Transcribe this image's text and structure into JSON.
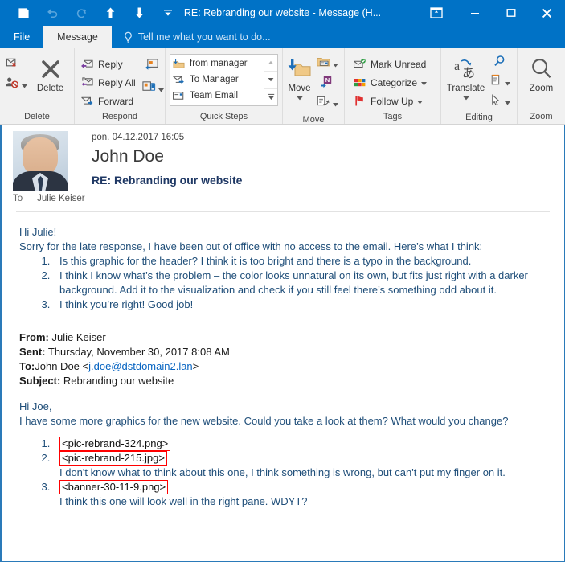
{
  "titlebar": {
    "quick_access": [
      {
        "name": "save",
        "icon": "save-icon",
        "enabled": true
      },
      {
        "name": "undo",
        "icon": "undo-icon",
        "enabled": false
      },
      {
        "name": "redo",
        "icon": "redo-icon",
        "enabled": false
      },
      {
        "name": "previous-item",
        "icon": "up-arrow-icon",
        "enabled": true
      },
      {
        "name": "next-item",
        "icon": "down-arrow-icon",
        "enabled": true
      },
      {
        "name": "customize-quick-access-toolbar",
        "icon": "chevron-down-icon",
        "enabled": true
      }
    ],
    "title": "RE: Rebranding our website - Message (H...",
    "window_controls": [
      {
        "name": "ribbon-display-options",
        "icon": "ribbon-options-icon"
      },
      {
        "name": "minimize",
        "icon": "minimize-icon"
      },
      {
        "name": "maximize",
        "icon": "maximize-icon"
      },
      {
        "name": "close",
        "icon": "close-icon"
      }
    ]
  },
  "tabs": {
    "file": "File",
    "message": "Message",
    "tellme_placeholder": "Tell me what you want to do...",
    "tellme_icon": "lightbulb-icon"
  },
  "ribbon": {
    "groups": [
      {
        "label": "Delete",
        "buttons": [
          {
            "label": "",
            "name": "ignore-button",
            "icon": "ignore-icon"
          },
          {
            "label": "",
            "name": "junk-button",
            "icon": "junk-person-icon"
          },
          {
            "label": "Delete",
            "name": "delete-button",
            "icon": "delete-x-icon"
          }
        ]
      },
      {
        "label": "Respond",
        "buttons": [
          {
            "label": "Reply",
            "name": "reply-button",
            "icon": "reply-icon"
          },
          {
            "label": "Reply All",
            "name": "reply-all-button",
            "icon": "reply-all-icon"
          },
          {
            "label": "Forward",
            "name": "forward-button",
            "icon": "forward-icon"
          },
          {
            "label": "",
            "name": "meeting-button",
            "icon": "meeting-icon"
          },
          {
            "label": "",
            "name": "more-respond-button",
            "icon": "more-respond-icon"
          }
        ]
      },
      {
        "label": "Quick Steps",
        "items": [
          {
            "label": "from manager",
            "name": "quick-step-from-manager",
            "icon": "move-to-folder-icon"
          },
          {
            "label": "To Manager",
            "name": "quick-step-to-manager",
            "icon": "forward-mail-icon"
          },
          {
            "label": "Team Email",
            "name": "quick-step-team-email",
            "icon": "team-email-icon"
          }
        ],
        "has_dialog_launcher": true
      },
      {
        "label": "Move",
        "buttons": [
          {
            "label": "Move",
            "name": "move-button",
            "icon": "move-folder-icon"
          },
          {
            "label": "",
            "name": "rules-button",
            "icon": "rules-icon"
          },
          {
            "label": "",
            "name": "onenote-button",
            "icon": "onenote-icon"
          },
          {
            "label": "",
            "name": "actions-button",
            "icon": "actions-icon"
          }
        ]
      },
      {
        "label": "Tags",
        "buttons": [
          {
            "label": "Mark Unread",
            "name": "mark-unread-button",
            "icon": "mark-unread-icon"
          },
          {
            "label": "Categorize",
            "name": "categorize-button",
            "icon": "categorize-icon"
          },
          {
            "label": "Follow Up",
            "name": "follow-up-button",
            "icon": "flag-icon"
          }
        ],
        "has_dialog_launcher": true
      },
      {
        "label": "Editing",
        "buttons": [
          {
            "label": "Translate",
            "name": "translate-button",
            "icon": "translate-icon"
          },
          {
            "label": "",
            "name": "find-button",
            "icon": "magnifier-icon"
          },
          {
            "label": "",
            "name": "related-button",
            "icon": "related-document-icon"
          },
          {
            "label": "",
            "name": "select-button",
            "icon": "select-cursor-icon"
          }
        ]
      },
      {
        "label": "Zoom",
        "buttons": [
          {
            "label": "Zoom",
            "name": "zoom-button",
            "icon": "magnifier-large-icon"
          }
        ]
      }
    ]
  },
  "message": {
    "date": "pon. 04.12.2017 16:05",
    "sender": "John Doe",
    "subject": "RE: Rebranding our website",
    "to_label": "To",
    "to_value": "Julie Keiser",
    "avatar_name": "sender-avatar",
    "reply": {
      "greeting": "Hi Julie!",
      "intro": "Sorry for the late response, I have been out of office with no access to the email. Here’s what I think:",
      "points": [
        "Is this graphic for the header? I think it is too bright and there is a typo in the background.",
        "I think I know what’s the problem – the color looks unnatural on its own, but fits just right with a darker background. Add it to the visualization and check if you still feel there’s something odd about it.",
        "I think you’re right! Good job!"
      ]
    },
    "quoted_headers": [
      {
        "key": "From:",
        "value": "Julie Keiser"
      },
      {
        "key": "Sent:",
        "value": "Thursday, November 30, 2017 8:08 AM"
      },
      {
        "key": "To:",
        "value": "John Doe <",
        "link": "j.doe@dstdomain2.lan",
        "value_after": ">"
      },
      {
        "key": "Subject:",
        "value": "Rebranding our website"
      }
    ],
    "quoted_body": {
      "greeting": "Hi Joe,",
      "intro": "I have some more graphics for the new website. Could you take a look at them? What would you change?",
      "items": [
        {
          "boxed": "<pic-rebrand-324.png>",
          "note": ""
        },
        {
          "boxed": "<pic-rebrand-215.jpg>",
          "note": "I don't know what to think about this one, I think something is wrong, but can't put my finger on it."
        },
        {
          "boxed": "<banner-30-11-9.png>",
          "note": "I think this one will look well in the right pane. WDYT?"
        }
      ]
    }
  },
  "colors": {
    "accent": "#0072c6",
    "ribbon_bg": "#f1f1f1",
    "body_text": "#1f4e79",
    "subject_text": "#1f3864",
    "highlight_box": "#ff0000",
    "link": "#0563c1",
    "pane_border": "#2a7ab9"
  }
}
